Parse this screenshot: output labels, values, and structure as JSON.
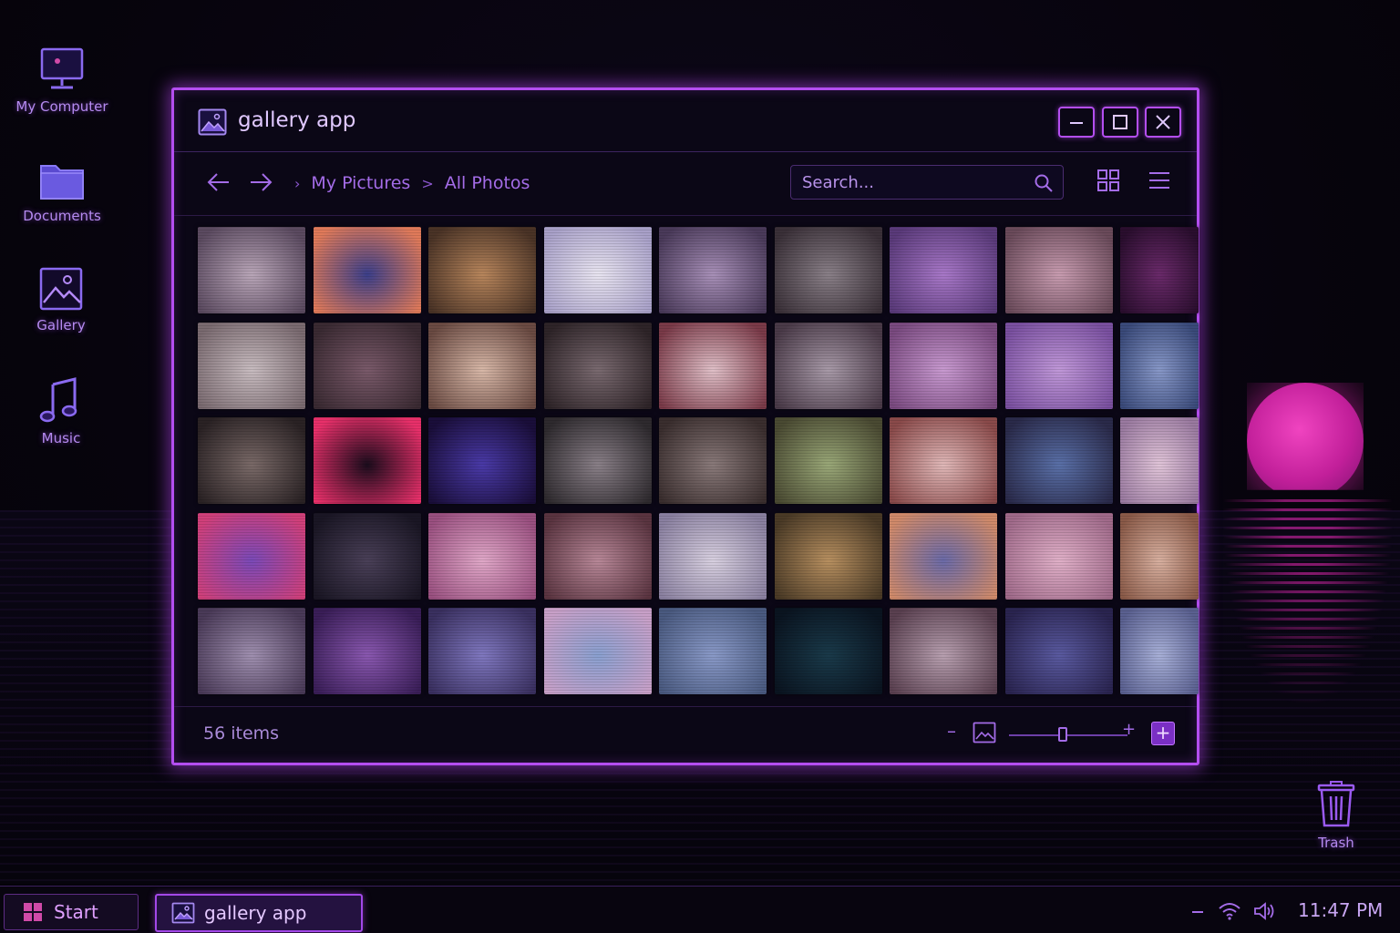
{
  "desktop": {
    "icons": [
      {
        "label": "My Computer"
      },
      {
        "label": "Documents"
      },
      {
        "label": "Gallery"
      },
      {
        "label": "Music"
      },
      {
        "label": "Trash"
      }
    ]
  },
  "window": {
    "title": "gallery app",
    "breadcrumb": [
      "My Pictures",
      "All Photos"
    ],
    "search_placeholder": "Search...",
    "status_count": "56 items",
    "zoom_value": 0.45
  },
  "thumbnails": [
    {
      "subject": "cat",
      "colors": [
        "#b9a6b8",
        "#5b4a60"
      ]
    },
    {
      "subject": "sunset-beach",
      "colors": [
        "#3b3f8a",
        "#e07a5a"
      ]
    },
    {
      "subject": "cat",
      "colors": [
        "#b8865c",
        "#4a3326"
      ]
    },
    {
      "subject": "anime-sketch",
      "colors": [
        "#e8e4f0",
        "#a8a0c8"
      ]
    },
    {
      "subject": "couple-beach",
      "colors": [
        "#a890b8",
        "#4a3a5a"
      ]
    },
    {
      "subject": "cat",
      "colors": [
        "#8a8088",
        "#3a3038"
      ]
    },
    {
      "subject": "cake",
      "colors": [
        "#a878c8",
        "#5a3a7a"
      ]
    },
    {
      "subject": "cake",
      "colors": [
        "#c89cb0",
        "#6a4a5a"
      ]
    },
    {
      "subject": "cat",
      "colors": [
        "#6a2a6a",
        "#2a0e2e"
      ]
    },
    {
      "subject": "anime-girl",
      "colors": [
        "#c8bcc0",
        "#7a6a70"
      ]
    },
    {
      "subject": "cake",
      "colors": [
        "#7a5a6a",
        "#3a2a32"
      ]
    },
    {
      "subject": "cake",
      "colors": [
        "#d8b8a8",
        "#6a4a42"
      ]
    },
    {
      "subject": "cat",
      "colors": [
        "#7a6a70",
        "#2e2428"
      ]
    },
    {
      "subject": "cake",
      "colors": [
        "#e0c0c8",
        "#7a3a48"
      ]
    },
    {
      "subject": "cake",
      "colors": [
        "#a89aa8",
        "#4a3a48"
      ]
    },
    {
      "subject": "anime-girl",
      "colors": [
        "#c89ad0",
        "#7a4a80"
      ]
    },
    {
      "subject": "anime-sketch",
      "colors": [
        "#c098d8",
        "#7a50a0"
      ]
    },
    {
      "subject": "anime-girl",
      "colors": [
        "#8898c8",
        "#3a4a7a"
      ]
    },
    {
      "subject": "cat",
      "colors": [
        "#7a6a68",
        "#2a2224"
      ]
    },
    {
      "subject": "neon-love",
      "colors": [
        "#1a0c1c",
        "#e8306a"
      ]
    },
    {
      "subject": "neon-city",
      "colors": [
        "#4a3aa8",
        "#1a0e3a"
      ]
    },
    {
      "subject": "cat",
      "colors": [
        "#8a8088",
        "#2e2a2e"
      ]
    },
    {
      "subject": "cat",
      "colors": [
        "#8a7a7a",
        "#3a2e2e"
      ]
    },
    {
      "subject": "cake",
      "colors": [
        "#9aa878",
        "#4a4a32"
      ]
    },
    {
      "subject": "cake",
      "colors": [
        "#e0b8b8",
        "#8a4a4a"
      ]
    },
    {
      "subject": "couple-beach",
      "colors": [
        "#5a70a8",
        "#2a2a4a"
      ]
    },
    {
      "subject": "anime-girl",
      "colors": [
        "#e0c4d8",
        "#9a7aa0"
      ]
    },
    {
      "subject": "sunset-sea",
      "colors": [
        "#7a4ab8",
        "#d0407a"
      ]
    },
    {
      "subject": "cat",
      "colors": [
        "#4a4058",
        "#1a1624"
      ]
    },
    {
      "subject": "cake",
      "colors": [
        "#e0a8c8",
        "#9a5080"
      ]
    },
    {
      "subject": "cake",
      "colors": [
        "#b88898",
        "#5a3440"
      ]
    },
    {
      "subject": "anime-sketch",
      "colors": [
        "#d8d0e0",
        "#8a80a0"
      ]
    },
    {
      "subject": "cat",
      "colors": [
        "#b89060",
        "#4a3a26"
      ]
    },
    {
      "subject": "sunset-beach",
      "colors": [
        "#6a6aa8",
        "#d08a6a"
      ]
    },
    {
      "subject": "anime-girl",
      "colors": [
        "#e0b0c8",
        "#a06a8a"
      ]
    },
    {
      "subject": "cake",
      "colors": [
        "#d8b0a0",
        "#8a5a48"
      ]
    },
    {
      "subject": "cat",
      "colors": [
        "#a090b0",
        "#4a3a58"
      ]
    },
    {
      "subject": "cat",
      "colors": [
        "#8a58b0",
        "#3a1e58"
      ]
    },
    {
      "subject": "couple-beach",
      "colors": [
        "#8078c0",
        "#3a3060"
      ]
    },
    {
      "subject": "beach",
      "colors": [
        "#8aa0d0",
        "#c8a0c8"
      ]
    },
    {
      "subject": "anime-girl",
      "colors": [
        "#8a9ac8",
        "#4a5a80"
      ]
    },
    {
      "subject": "forest-night",
      "colors": [
        "#1a3a4a",
        "#0a1420"
      ]
    },
    {
      "subject": "couple-beach",
      "colors": [
        "#b8a0b0",
        "#5a4050"
      ]
    },
    {
      "subject": "ferris-wheel",
      "colors": [
        "#5a5aa0",
        "#2a2450"
      ]
    },
    {
      "subject": "anime-girl",
      "colors": [
        "#a8b0d8",
        "#5a6090"
      ]
    }
  ],
  "taskbar": {
    "start_label": "Start",
    "app_label": "gallery app",
    "clock": "11:47 PM"
  },
  "theme": {
    "accent": "#b44ef0",
    "moon": "#e02fb0"
  }
}
